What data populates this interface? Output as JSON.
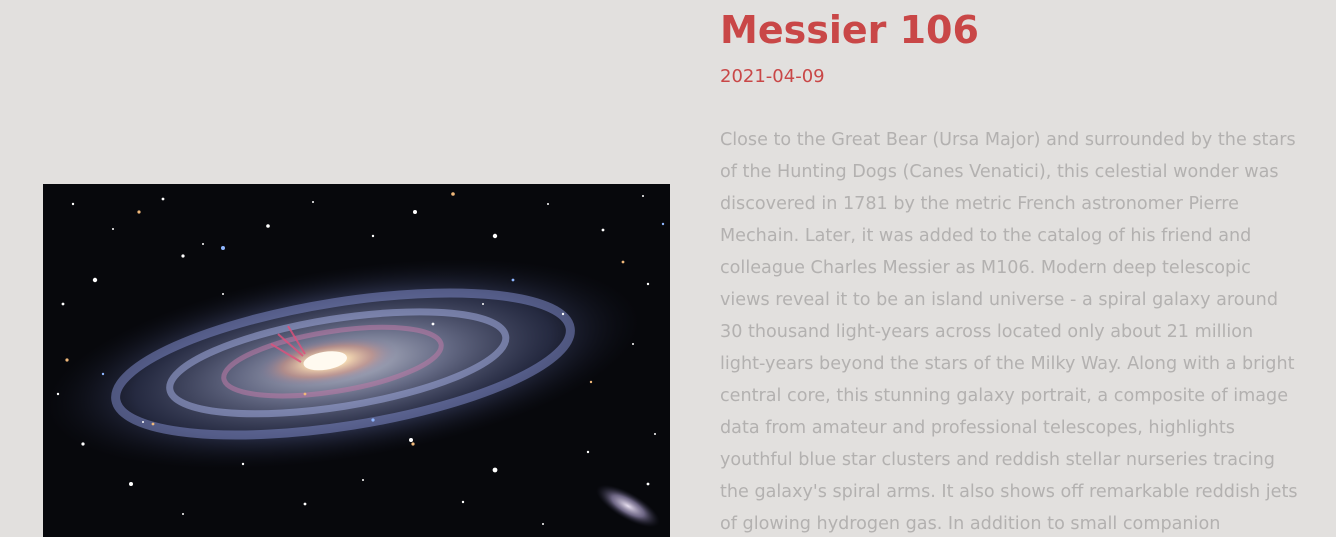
{
  "entry": {
    "title": "Messier 106",
    "date": "2021-04-09",
    "image_subject": "spiral galaxy M106 with small companion galaxy",
    "description": "Close to the Great Bear (Ursa Major) and surrounded by the stars of the Hunting Dogs (Canes Venatici), this celestial wonder was discovered in 1781 by the metric French astronomer Pierre Mechain. Later, it was added to the catalog of his friend and colleague Charles Messier as M106. Modern deep telescopic views reveal it to be an island universe - a spiral galaxy around 30 thousand light-years across located only about 21 million light-years beyond the stars of the Milky Way. Along with a bright central core, this stunning galaxy portrait, a composite of image data from amateur and professional telescopes, highlights youthful blue star clusters and reddish stellar nurseries tracing the galaxy's spiral arms. It also shows off remarkable reddish jets of glowing hydrogen gas. In addition to small companion"
  },
  "colors": {
    "background": "#e2e0de",
    "title": "#c94747",
    "date": "#c94747",
    "description": "#b3b1b0"
  }
}
